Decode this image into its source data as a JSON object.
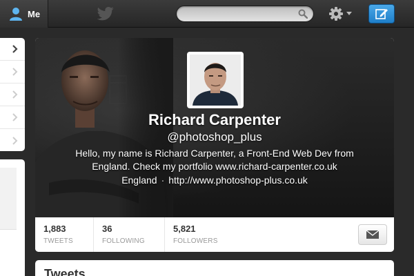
{
  "topbar": {
    "me_label": "Me",
    "search_placeholder": ""
  },
  "profile": {
    "name": "Richard Carpenter",
    "handle": "@photoshop_plus",
    "bio": "Hello, my name is Richard Carpenter, a Front-End Web Dev from England. Check my portfolio www.richard-carpenter.co.uk",
    "location": "England",
    "separator": "·",
    "website": "http://www.photoshop-plus.co.uk"
  },
  "stats": [
    {
      "value": "1,883",
      "label": "TWEETS"
    },
    {
      "value": "36",
      "label": "FOLLOWING"
    },
    {
      "value": "5,821",
      "label": "FOLLOWERS"
    }
  ],
  "tweets_panel": {
    "title": "Tweets"
  },
  "colors": {
    "accent": "#1f7fc9",
    "topbar": "#2e2e2e",
    "user_icon": "#5eb5f0"
  },
  "icons": {
    "user": "user-icon",
    "bird": "twitter-bird-icon",
    "search": "search-icon",
    "gear": "gear-icon",
    "compose": "compose-icon",
    "chevron": "chevron-right-icon",
    "envelope": "envelope-icon"
  }
}
